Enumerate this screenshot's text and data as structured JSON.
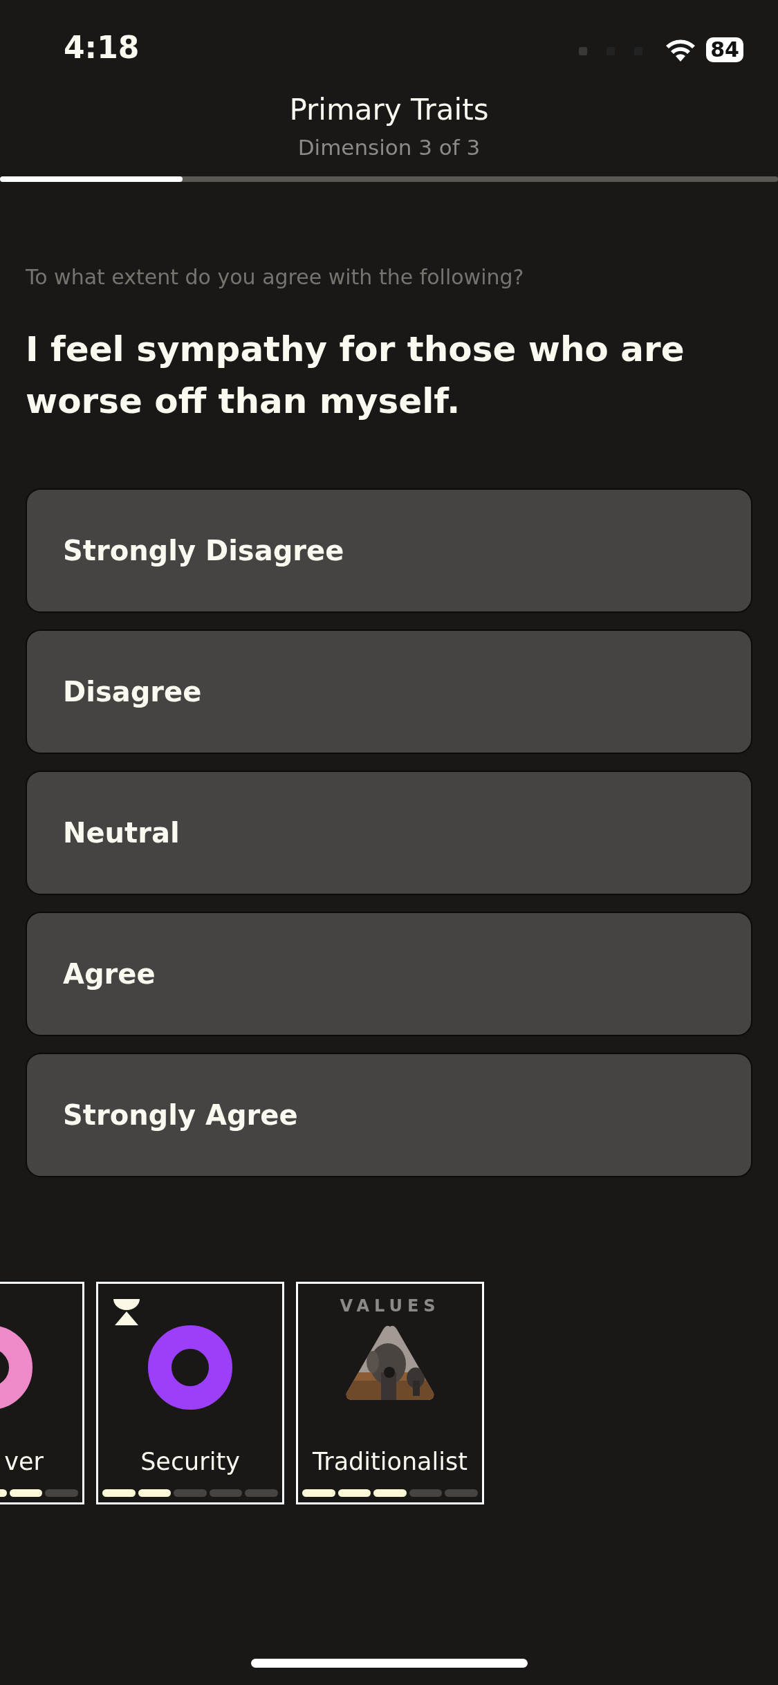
{
  "status_bar": {
    "time": "4:18",
    "battery": "84"
  },
  "header": {
    "title": "Primary Traits",
    "subtitle": "Dimension 3 of 3",
    "progress": {
      "level": 0.235
    }
  },
  "prompt": "To what extent do you agree with the following?",
  "question": "I feel sympathy for those who are worse off than myself.",
  "options": [
    {
      "label": "Strongly Disagree"
    },
    {
      "label": "Disagree"
    },
    {
      "label": "Neutral"
    },
    {
      "label": "Agree"
    },
    {
      "label": "Strongly Agree"
    }
  ],
  "cards": [
    {
      "kind": "ring",
      "color": "#ef8ac9",
      "title": "ver",
      "level": 0.8,
      "hourglass": false
    },
    {
      "kind": "ring",
      "color": "#9b3ff8",
      "title": "Security",
      "level": 0.4,
      "hourglass": true
    },
    {
      "kind": "picture",
      "category": "VALUES",
      "title": "Traditionalist",
      "level": 0.6,
      "hourglass": false
    }
  ]
}
